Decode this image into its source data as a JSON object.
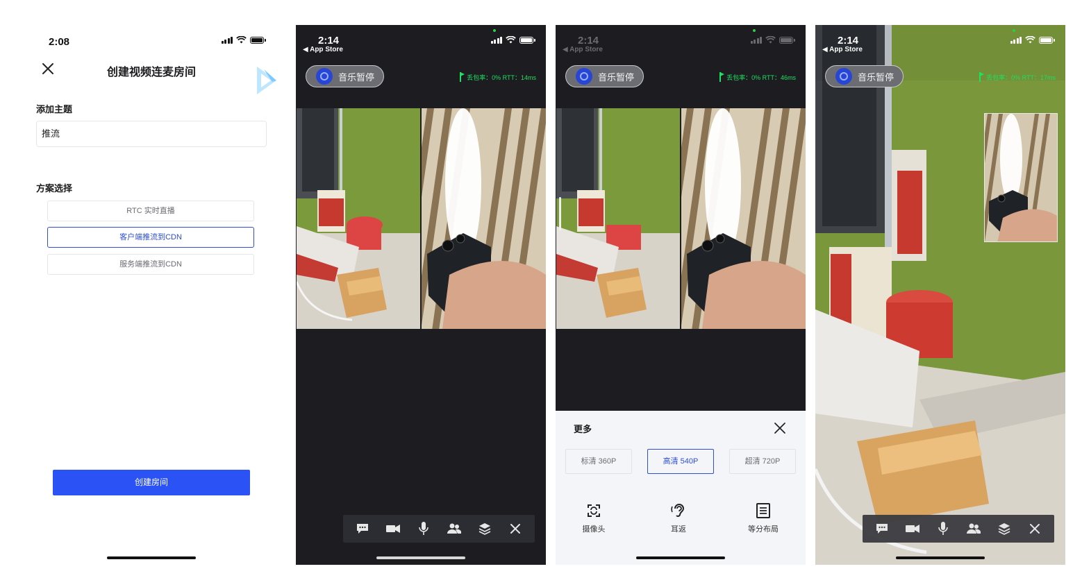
{
  "screens": {
    "create_room": {
      "status_time": "2:08",
      "title": "创建视频连麦房间",
      "topic_label": "添加主题",
      "topic_value": "推流",
      "scheme_label": "方案选择",
      "options": [
        "RTC 实时直播",
        "客户端推流到CDN",
        "服务端推流到CDN"
      ],
      "selected_option": "客户端推流到CDN",
      "create_button": "创建房间"
    },
    "live_room": {
      "status_time": "2:14",
      "back_label": "◀ App Store",
      "music_button": "音乐暂停",
      "stats": "丢包率：0%  RTT：14ms"
    },
    "live_room_more": {
      "status_time": "2:14",
      "back_label": "◀ App Store",
      "music_button": "音乐暂停",
      "stats": "丢包率：0%  RTT：46ms",
      "sheet_title": "更多",
      "qualities": [
        "标清 360P",
        "高清 540P",
        "超清 720P"
      ],
      "selected_quality": "高清 540P",
      "functions": [
        "摄像头",
        "耳返",
        "等分布局"
      ]
    },
    "live_room_pip": {
      "status_time": "2:14",
      "back_label": "◀ App Store",
      "music_button": "音乐暂停",
      "stats": "丢包率：0%  RTT：17ms"
    }
  },
  "toolbar_icons": [
    "chat-icon",
    "camera-icon",
    "mic-icon",
    "members-icon",
    "layers-icon",
    "close-icon"
  ],
  "colors": {
    "accent": "#2a52f5",
    "selected_border": "#2e4ed6",
    "stats_green": "#1fe060",
    "dark_bg": "#1c1c21"
  }
}
